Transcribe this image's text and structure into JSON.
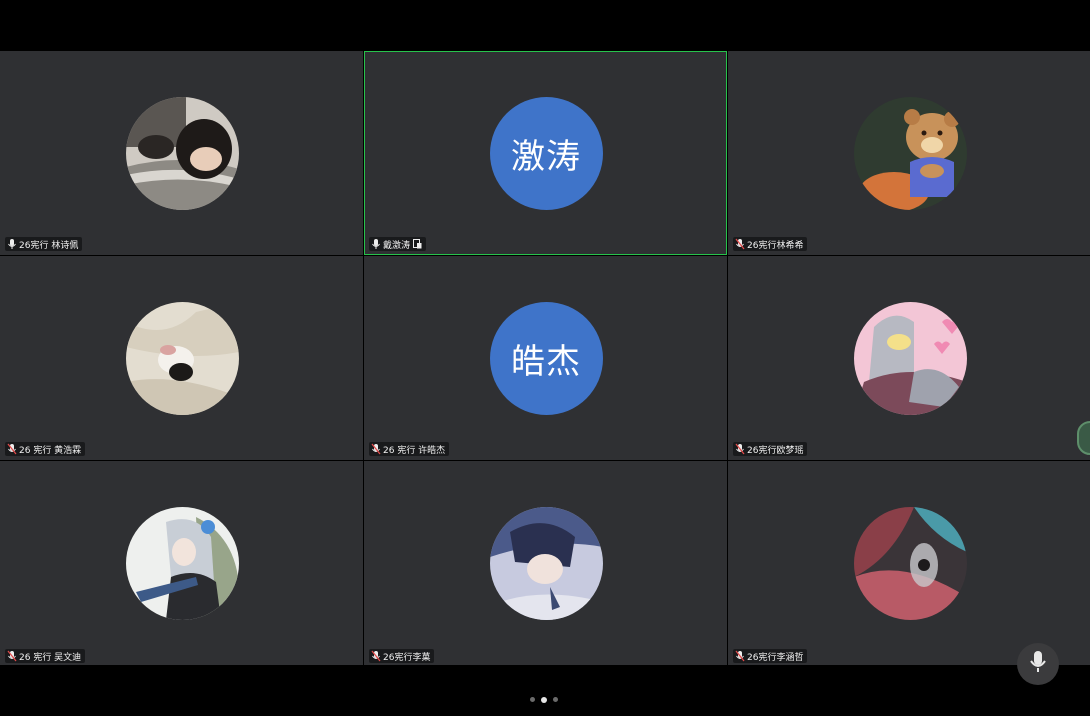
{
  "meeting": {
    "tiles": [
      {
        "name": "26宪行 林诗佩",
        "avatar": "photo-girl-icon",
        "mic": "mic-on"
      },
      {
        "name": "戴激涛",
        "avatar_text": "激涛",
        "mic": "mic-on",
        "badge": "share-icon",
        "active": true
      },
      {
        "name": "26宪行林希希",
        "avatar": "bear-cartoon-icon",
        "mic": "mic-muted"
      },
      {
        "name": "26 宪行 黄浩霖",
        "avatar": "cat-photo-icon",
        "mic": "mic-muted"
      },
      {
        "name": "26 宪行 许皓杰",
        "avatar_text": "皓杰",
        "mic": "mic-muted"
      },
      {
        "name": "26宪行欧梦瑶",
        "avatar": "ultraman-icon",
        "mic": "mic-muted"
      },
      {
        "name": "26 宪行 吴文迪",
        "avatar": "anime-girl-icon",
        "mic": "mic-muted"
      },
      {
        "name": "26宪行李菓",
        "avatar": "anime-boy-icon",
        "mic": "mic-muted"
      },
      {
        "name": "26宪行李涵哲",
        "avatar": "abstract-art-icon",
        "mic": "mic-muted"
      }
    ],
    "pager": {
      "pages": 3,
      "current": 2
    },
    "colors": {
      "tile_bg": "#2f3033",
      "active_border": "#27c24c",
      "text_avatar_bg": "#3f74c9"
    }
  }
}
